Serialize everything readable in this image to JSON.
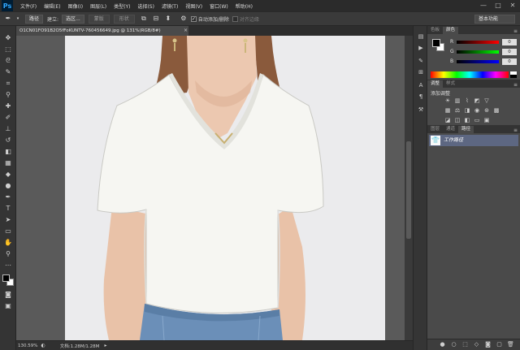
{
  "app": {
    "logo": "Ps",
    "menus": [
      "文件(F)",
      "编辑(E)",
      "图像(I)",
      "图层(L)",
      "类型(Y)",
      "选择(S)",
      "滤镜(T)",
      "视图(V)",
      "窗口(W)",
      "帮助(H)"
    ],
    "window_controls": [
      "—",
      "□",
      "✕"
    ]
  },
  "options_bar": {
    "mode_select": "路径",
    "build_label": "建立:",
    "selection_button": "选区...",
    "mask_button": "蒙版",
    "shape_button": "形状",
    "auto_add_delete_label": "自动添加/删除",
    "align_edges_label": "对齐边缘",
    "workspace": "基本功能"
  },
  "document": {
    "tab_title": "O1CN01FO91B2O5fFoKUNTV-760456649.jpg @ 131%(RGB/8#)",
    "tab_close": "×",
    "zoom": "130.59%",
    "doc_info": "文档:1.28M/1.28M"
  },
  "color_panel": {
    "tabs": [
      "色板",
      "颜色"
    ],
    "active_tab": 1,
    "channels": [
      {
        "label": "R",
        "value": "0",
        "gradient": "linear-gradient(to right,#000,#ff0000)"
      },
      {
        "label": "G",
        "value": "0",
        "gradient": "linear-gradient(to right,#000,#00ff00)"
      },
      {
        "label": "B",
        "value": "0",
        "gradient": "linear-gradient(to right,#000,#0000ff)"
      }
    ]
  },
  "adjustments_panel": {
    "tabs": [
      "调整",
      "样式"
    ],
    "active_tab": 0,
    "title": "添加调整"
  },
  "layers_panel": {
    "tabs": [
      "图层",
      "通道",
      "路径"
    ],
    "active_tab": 2,
    "work_path_name": "工作路径"
  },
  "colors": {
    "selection_highlight": "#5d6782",
    "canvas_bg": "#ebebed",
    "panel_bg": "#4a4a4a"
  }
}
